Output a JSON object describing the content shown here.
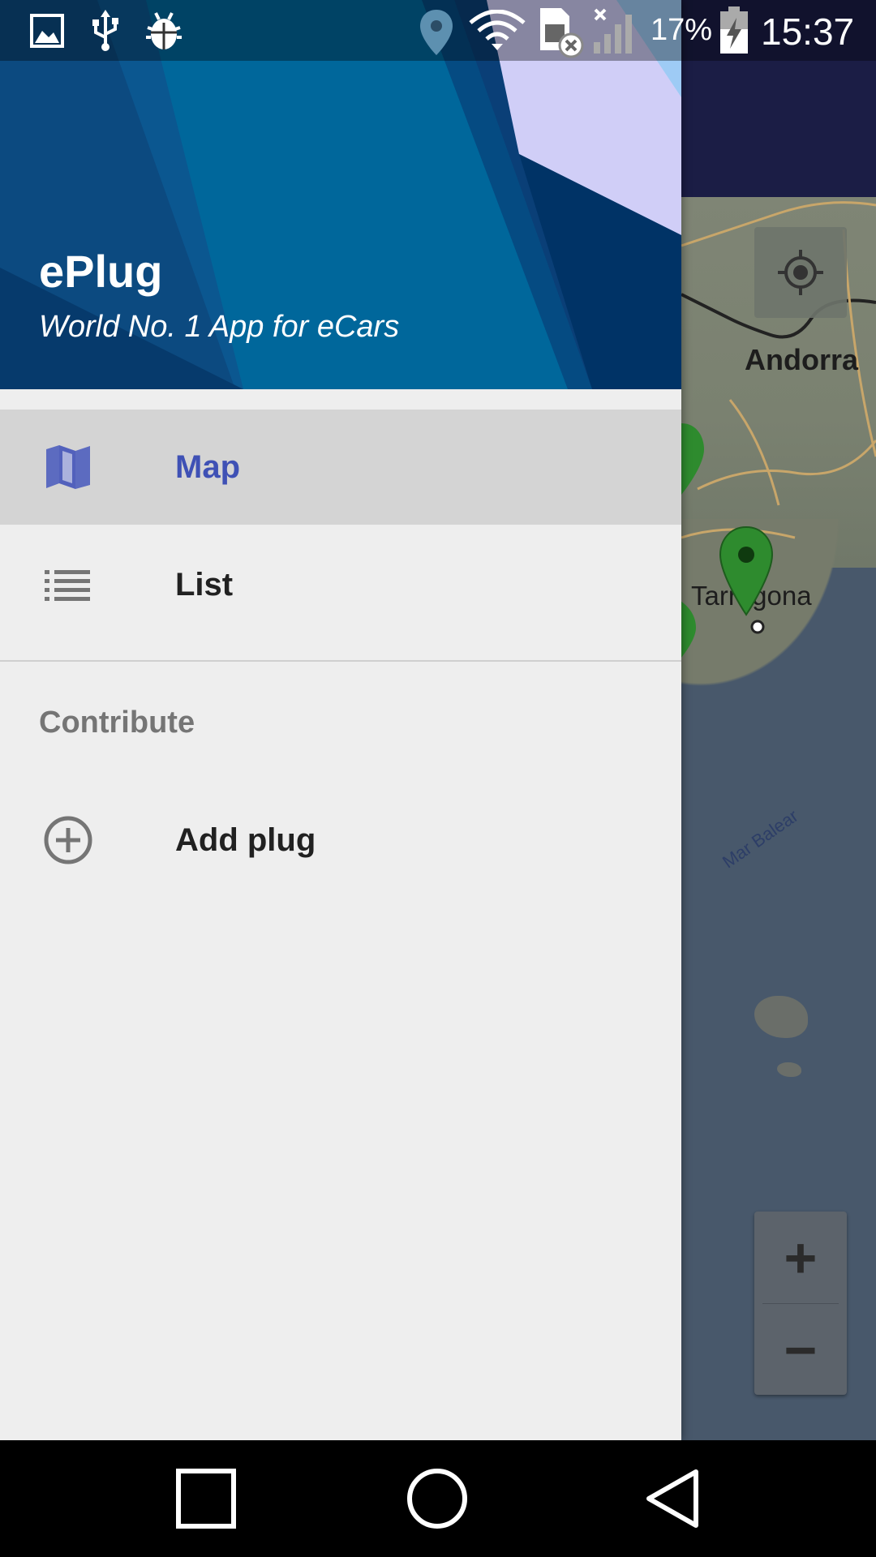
{
  "status_bar": {
    "battery_percent": "17%",
    "time": "15:37",
    "icons": [
      "image-icon",
      "usb-icon",
      "bug-icon",
      "location-icon",
      "wifi-icon",
      "sim-error-icon",
      "signal-icon",
      "battery-charging-icon"
    ]
  },
  "drawer": {
    "header": {
      "title": "ePlug",
      "subtitle": "World No. 1 App for eCars"
    },
    "items": [
      {
        "label": "Map",
        "icon": "map-icon",
        "selected": true
      },
      {
        "label": "List",
        "icon": "list-icon",
        "selected": false
      }
    ],
    "section": {
      "title": "Contribute",
      "items": [
        {
          "label": "Add plug",
          "icon": "add-circle-icon"
        }
      ]
    }
  },
  "map": {
    "labels": {
      "andorra": "Andorra",
      "tarragona": "Tarragona",
      "sea": "Mar Balear"
    },
    "controls": {
      "zoom_in": "+",
      "zoom_out": "−"
    }
  },
  "colors": {
    "toolbar": "#1b1d45",
    "header_blue": "#006699",
    "accent": "#3f51b5",
    "pin_green": "#2e8b2e"
  }
}
